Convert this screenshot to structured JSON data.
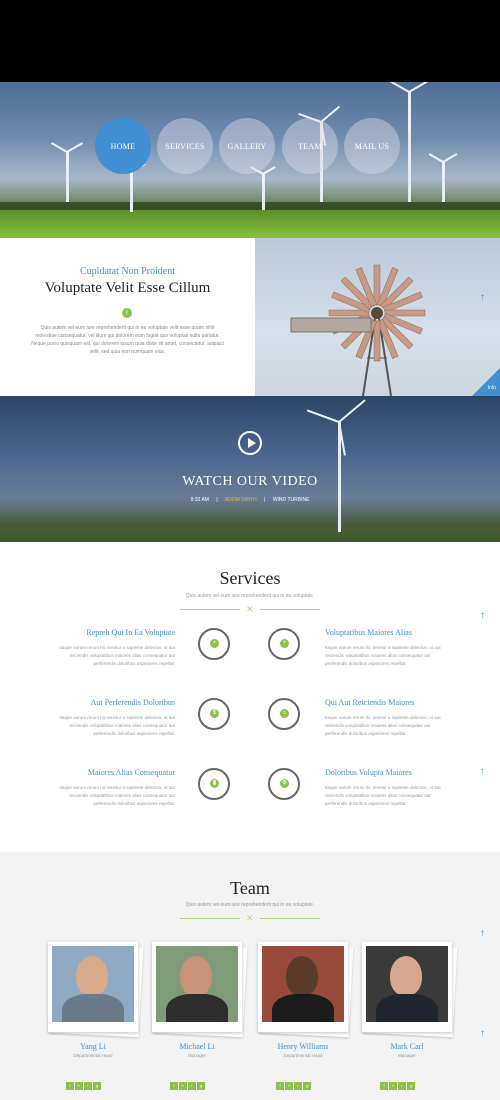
{
  "nav": {
    "items": [
      "HOME",
      "SERVICES",
      "GALLERY",
      "TEAM",
      "MAIL US"
    ]
  },
  "intro": {
    "kicker": "Cupidatat Non Proident",
    "title": "Voluptate Velit Esse Cillum",
    "body": "Quis autem vel eum iure reprehenderit qui in ea voluptate velit esse quam nihil molestiae consequatur, vel illum qui dolorem eum fugiat quo voluptas nulla pariatur. Neque porro quisquam est, qui dolorem ipsum quia dolor sit amet, consectetur, adipisci velit, sed quia non numquam eius.",
    "corner_label": "Info"
  },
  "video": {
    "title": "WATCH OUR VIDEO",
    "time": "9:32 AM",
    "author": "ADOM SMITH",
    "tag": "WIND TURBINE"
  },
  "services": {
    "title": "Services",
    "subtitle": "Quis autem vel eum iure reprehenderit qui in ea voluptate.",
    "body_text": "Itaque earum rerum hic tenetur a sapiente delectus, ut aut reiciendis voluptatibus maiores alias consequatur aut perferendis doloribus asperiores repellat.",
    "left": [
      {
        "title": "Repreh Qui In Ea Voluptate",
        "icon": "leaf-icon"
      },
      {
        "title": "Aut Perferendis Doloribus",
        "icon": "dollar-icon"
      },
      {
        "title": "Maiores Alias Consequatur",
        "icon": "bar-chart-icon"
      }
    ],
    "right": [
      {
        "title": "Voluptatibus Maiores Alias",
        "icon": "plus-icon"
      },
      {
        "title": "Qui Aut Reiciendis Maiores",
        "icon": "home-icon"
      },
      {
        "title": "Doloribus Volupta Maiores",
        "icon": "gear-icon"
      }
    ]
  },
  "team": {
    "title": "Team",
    "subtitle": "Quis autem vel eum iure reprehenderit qui in ea voluptate.",
    "members": [
      {
        "name": "Yang Li",
        "role": "Departmental Head"
      },
      {
        "name": "Michael Li",
        "role": "Manager"
      },
      {
        "name": "Henry Williams",
        "role": "Departmental Head"
      },
      {
        "name": "Mark Carl",
        "role": "Manager"
      }
    ]
  },
  "colors": {
    "accent": "#3f8fd2",
    "green": "#8bc34a"
  }
}
